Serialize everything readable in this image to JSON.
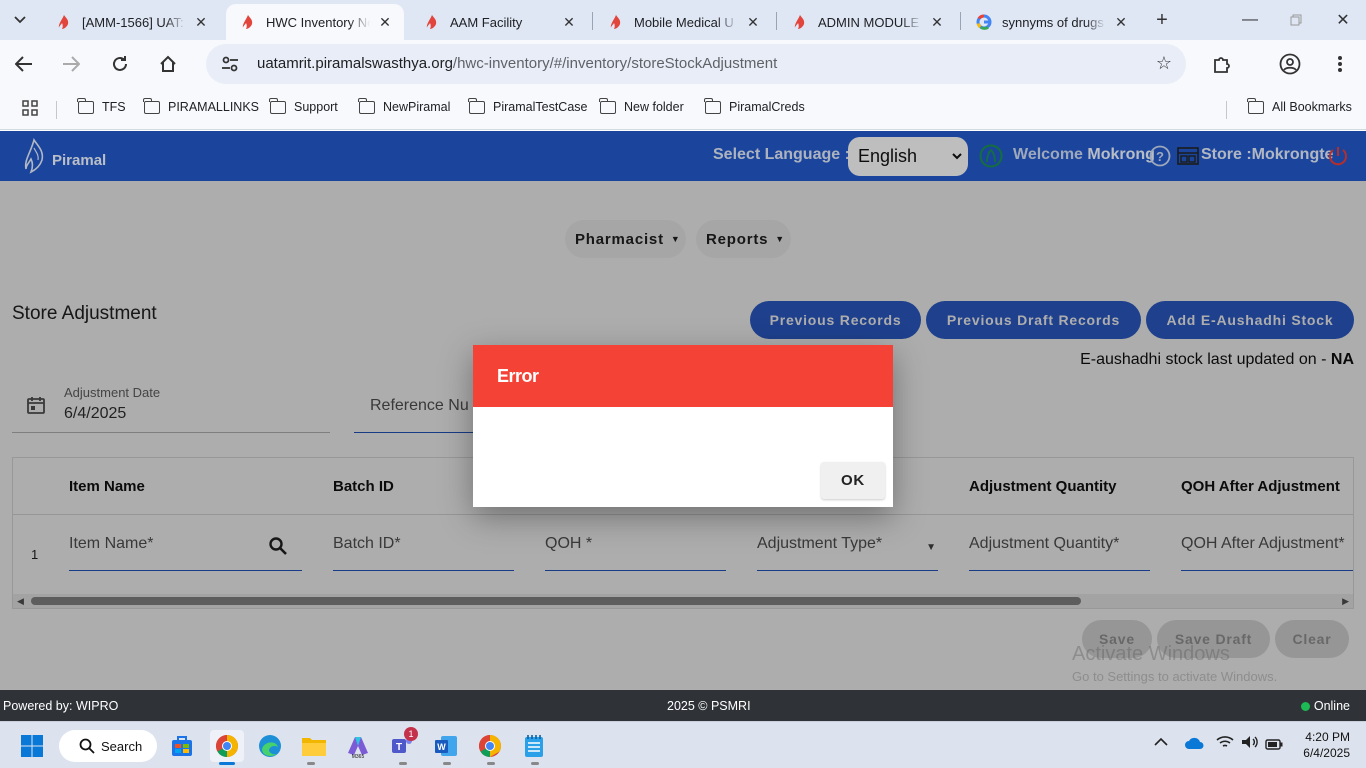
{
  "browser": {
    "tabs": [
      {
        "title": "[AMM-1566] UAT:",
        "active": false
      },
      {
        "title": "HWC Inventory Ne",
        "active": true
      },
      {
        "title": "AAM Facility",
        "active": false
      },
      {
        "title": "Mobile Medical U",
        "active": false
      },
      {
        "title": "ADMIN MODULE",
        "active": false
      },
      {
        "title": "synnyms of drugs",
        "active": false
      }
    ],
    "url_host": "uatamrit.piramalswasthya.org",
    "url_path": "/hwc-inventory/#/inventory/storeStockAdjustment",
    "bookmarks": [
      "TFS",
      "PIRAMALLINKS",
      "Support",
      "NewPiramal",
      "PiramalTestCase",
      "New folder",
      "PiramalCreds"
    ],
    "all_bookmarks": "All Bookmarks"
  },
  "header": {
    "logo_text": "Piramal",
    "select_language_label": "Select Language :",
    "language_value": "English",
    "welcome_label": "Welcome",
    "user_name": "Mokrong",
    "store_label": "Store :Mokrongte"
  },
  "nav": {
    "pharmacist": "Pharmacist",
    "reports": "Reports"
  },
  "page": {
    "title": "Store Adjustment",
    "buttons": {
      "previous_records": "Previous Records",
      "previous_draft_records": "Previous Draft Records",
      "add_eaushadhi": "Add E-Aushadhi Stock"
    },
    "eaushadhi_text": "E-aushadhi stock last updated on -",
    "eaushadhi_value": "NA",
    "adjustment_date_label": "Adjustment Date",
    "adjustment_date_value": "6/4/2025",
    "reference_placeholder": "Reference Nu"
  },
  "table": {
    "headers": [
      "Item Name",
      "Batch ID",
      "Adjustment Quantity",
      "QOH After Adjustment"
    ],
    "row_number": "1",
    "placeholders": {
      "item_name": "Item Name*",
      "batch_id": "Batch ID*",
      "qoh": "QOH *",
      "adjustment_type": "Adjustment Type*",
      "adjustment_quantity": "Adjustment Quantity*",
      "qoh_after": "QOH After Adjustment*"
    }
  },
  "actions": {
    "save": "Save",
    "save_draft": "Save Draft",
    "clear": "Clear"
  },
  "watermark": {
    "line1": "Activate Windows",
    "line2": "Go to Settings to activate Windows."
  },
  "dialog": {
    "title": "Error",
    "ok": "OK"
  },
  "footer": {
    "powered_by": "Powered by: WIPRO",
    "copyright": "2025 © PSMRI",
    "status": "Online"
  },
  "taskbar": {
    "search_label": "Search",
    "teams_badge": "1",
    "time": "4:20 PM",
    "date": "6/4/2025"
  },
  "colors": {
    "app_blue": "#2257c4",
    "error_red": "#f44336",
    "primary_button": "#2d5fd0"
  }
}
